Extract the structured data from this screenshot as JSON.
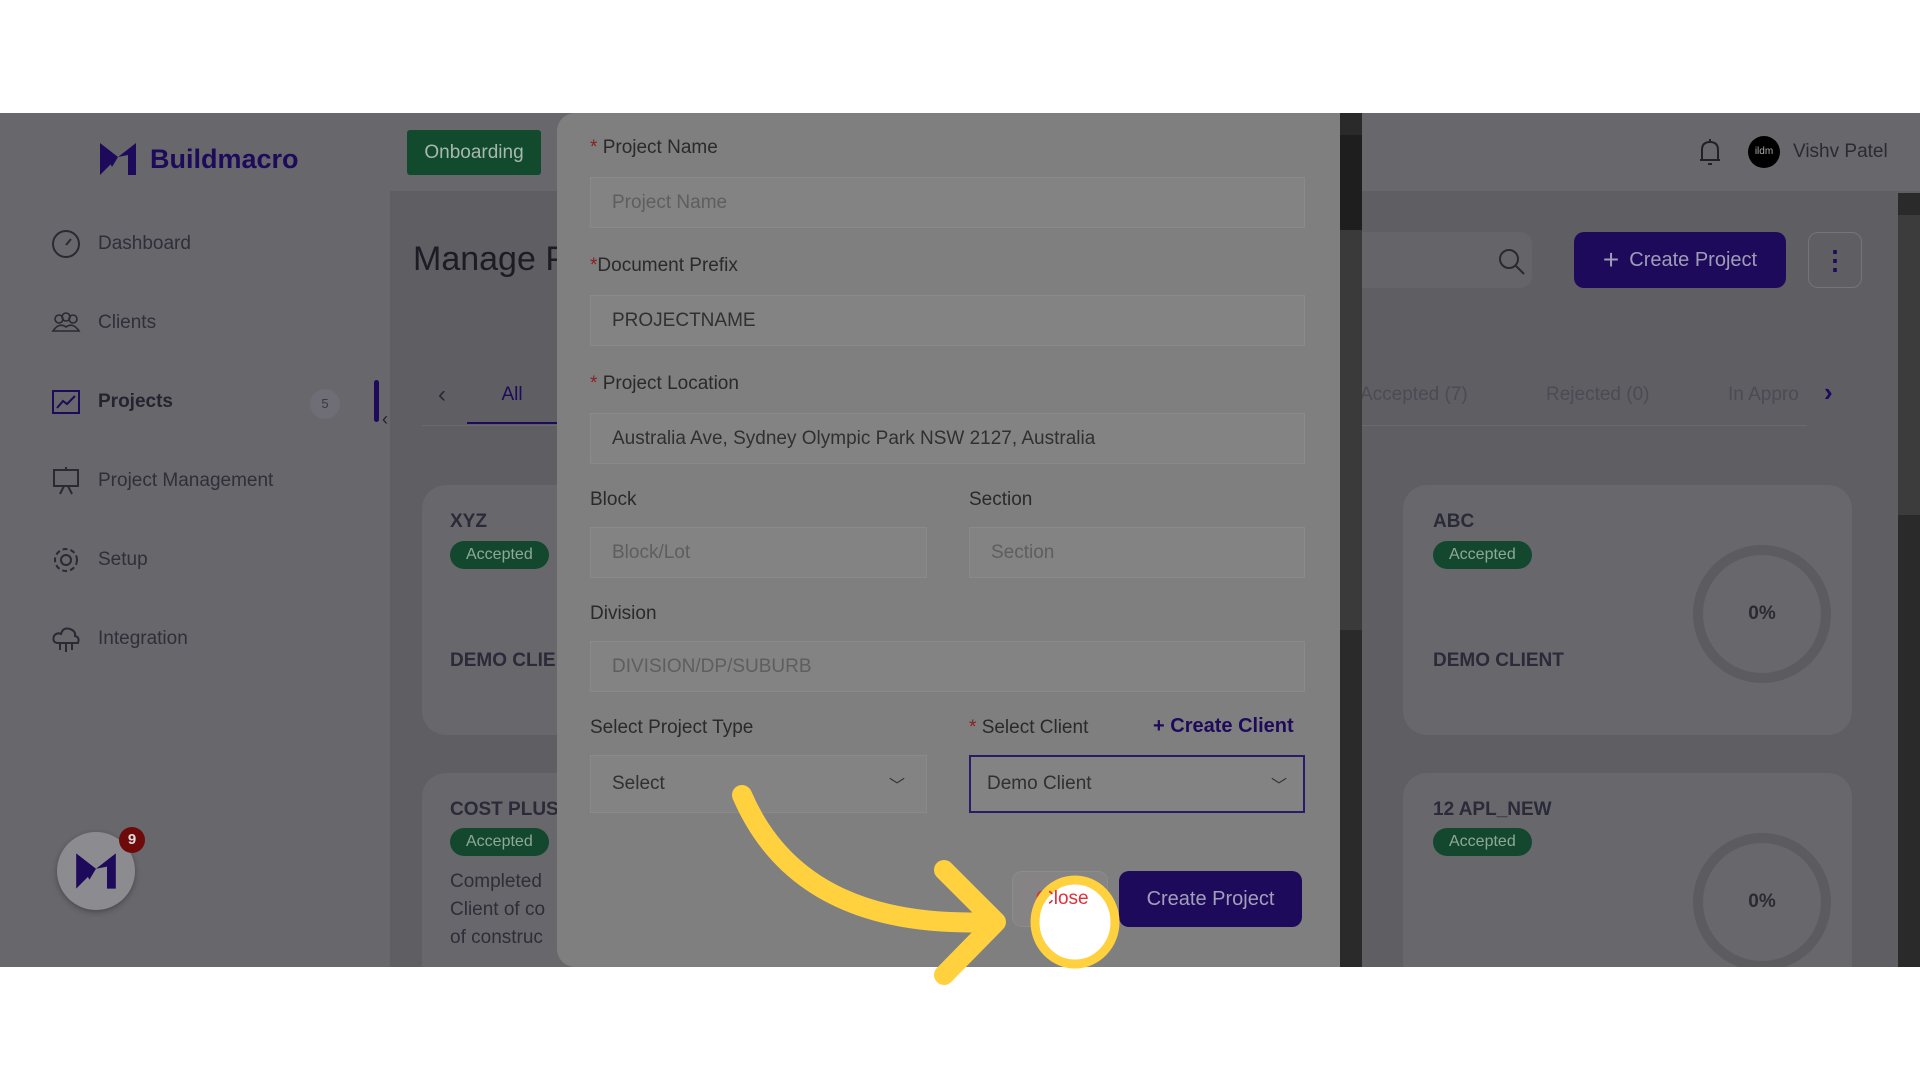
{
  "brand": {
    "name": "Buildmacro",
    "accent": "#1e0a5a"
  },
  "header": {
    "onboarding": "Onboarding",
    "user_name": "Vishv Patel",
    "avatar_text": "ildm"
  },
  "sidebar": {
    "items": [
      {
        "label": "Dashboard",
        "icon": "dashboard-gauge-icon"
      },
      {
        "label": "Clients",
        "icon": "clients-group-icon"
      },
      {
        "label": "Projects",
        "icon": "projects-chart-icon",
        "badge": "5",
        "active": true
      },
      {
        "label": "Project Management",
        "icon": "presentation-board-icon"
      },
      {
        "label": "Setup",
        "icon": "gear-icon"
      },
      {
        "label": "Integration",
        "icon": "cloud-network-icon"
      }
    ],
    "notification_count": "9"
  },
  "main": {
    "title": "Manage P",
    "create_project": "Create Project",
    "tabs": [
      {
        "label": "All"
      },
      {
        "label": "Accepted (7)"
      },
      {
        "label": "Rejected (0)"
      },
      {
        "label": "In Appro"
      }
    ],
    "cards": [
      {
        "title": "XYZ",
        "status": "Accepted",
        "client": "DEMO CLIE"
      },
      {
        "title": "COST PLUS",
        "status": "Accepted",
        "desc": [
          "Completed",
          "Client of co",
          "of construc"
        ]
      },
      {
        "title": "ABC",
        "status": "Accepted",
        "client": "DEMO CLIENT",
        "progress": "0%"
      },
      {
        "title": "12 APL_NEW",
        "status": "Accepted",
        "progress": "0%"
      }
    ]
  },
  "modal": {
    "project_name": {
      "label": "Project Name",
      "placeholder": "Project Name"
    },
    "document_prefix": {
      "label": "Document Prefix",
      "value": "PROJECTNAME"
    },
    "project_location": {
      "label": "Project Location",
      "value": "Australia Ave, Sydney Olympic Park NSW 2127, Australia"
    },
    "block": {
      "label": "Block",
      "placeholder": "Block/Lot"
    },
    "section": {
      "label": "Section",
      "placeholder": "Section"
    },
    "division": {
      "label": "Division",
      "placeholder": "DIVISION/DP/SUBURB"
    },
    "project_type": {
      "label": "Select Project Type",
      "value": "Select"
    },
    "client": {
      "label": "Select Client",
      "value": "Demo Client",
      "create": "Create Client"
    },
    "close": "Close",
    "close_visible": "lose",
    "submit": "Create Project"
  }
}
